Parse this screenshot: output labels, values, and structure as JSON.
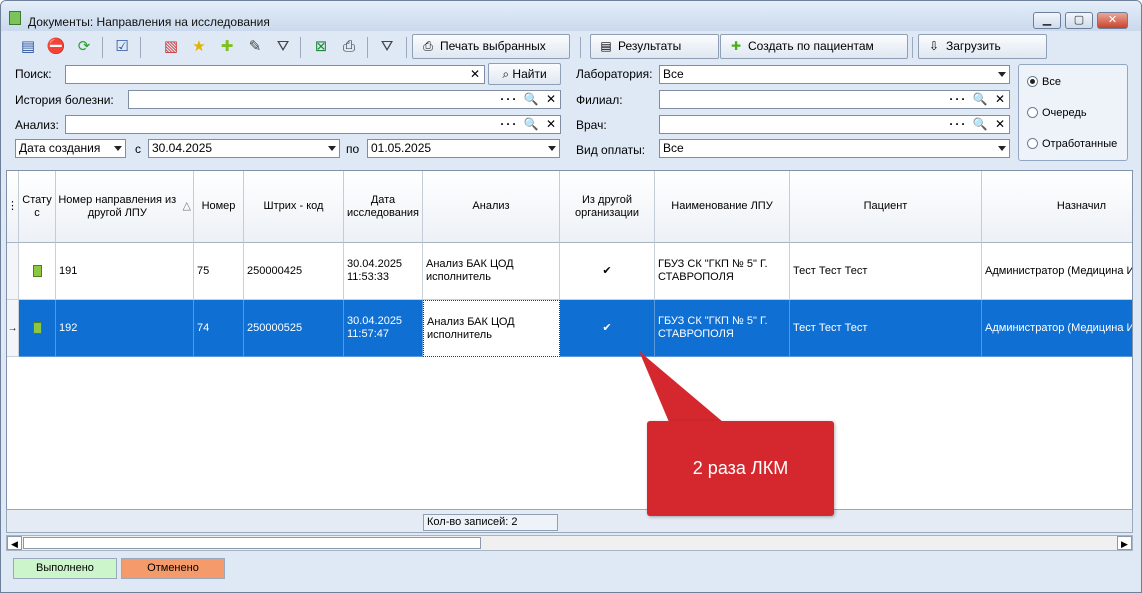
{
  "window": {
    "title": "Документы: Направления на исследования",
    "buttons": [
      "▁",
      "▢",
      "✕"
    ]
  },
  "toolbar": {
    "icons": [
      "document-edit-icon",
      "stop-icon",
      "refresh-icon",
      "checklist-icon",
      "delete-doc-icon",
      "star-icon",
      "add-icon",
      "edit-doc-icon",
      "filter-icon",
      "excel-icon",
      "print-icon",
      "clear-filter-icon"
    ],
    "print_selected": "Печать выбранных",
    "results": "Результаты",
    "create_by_patients": "Создать по пациентам",
    "load": "Загрузить"
  },
  "filters": {
    "search_label": "Поиск:",
    "search_value": "",
    "find_button": "Найти",
    "history_label": "История болезни:",
    "analysis_label": "Анализ:",
    "date_type": "Дата создания",
    "from_label": "с",
    "from_date": "30.04.2025",
    "to_label": "по",
    "to_date": "01.05.2025",
    "lab_label": "Лаборатория:",
    "lab_value": "Все",
    "branch_label": "Филиал:",
    "doctor_label": "Врач:",
    "payment_label": "Вид оплаты:",
    "payment_value": "Все",
    "lookup_icons": "··· 🔍 ✕"
  },
  "status_radio": {
    "options": [
      "Все",
      "Очередь",
      "Отработанные"
    ],
    "selected": "Все"
  },
  "grid": {
    "columns": [
      "Стату с",
      "Номер направления из другой ЛПУ",
      "Номер",
      "Штрих - код",
      "Дата исследования",
      "Анализ",
      "Из другой организации",
      "Наименование ЛПУ",
      "Пациент",
      "Назначил"
    ],
    "sort_indicator": "△",
    "rows": [
      {
        "ext_number": "191",
        "number": "75",
        "barcode": "250000425",
        "date": "30.04.2025",
        "time": "11:53:33",
        "analysis_1": "Анализ БАК ЦОД",
        "analysis_2": "исполнитель",
        "from_other_org": "✔",
        "lpu_1": "ГБУЗ СК \"ГКП № 5\" Г.",
        "lpu_2": "СТАВРОПОЛЯ",
        "patient": "Тест Тест Тест",
        "assigned_by": "Администратор (Медицина И"
      },
      {
        "ext_number": "192",
        "number": "74",
        "barcode": "250000525",
        "date": "30.04.2025",
        "time": "11:57:47",
        "analysis_1": "Анализ БАК ЦОД",
        "analysis_2": "исполнитель",
        "from_other_org": "✔",
        "lpu_1": "ГБУЗ СК \"ГКП № 5\" Г.",
        "lpu_2": "СТАВРОПОЛЯ",
        "patient": "Тест Тест Тест",
        "assigned_by": "Администратор (Медицина И"
      }
    ],
    "row_pointer": "→",
    "record_count": "Кол-во записей: 2"
  },
  "legend": {
    "done": "Выполнено",
    "cancelled": "Отменено",
    "done_color": "#ccf5cc",
    "cancelled_color": "#f59a6a"
  },
  "annotation": {
    "text": "2 раза ЛКМ",
    "color": "#d5282e"
  },
  "colors": {
    "selection": "#0f6fd2"
  }
}
